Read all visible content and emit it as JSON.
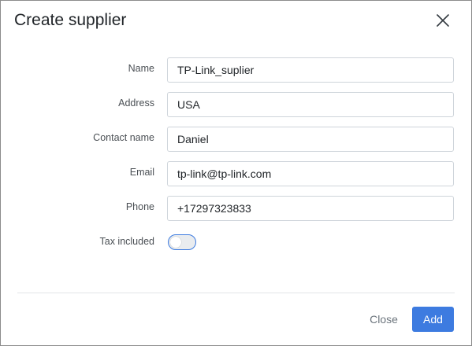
{
  "dialog": {
    "title": "Create supplier",
    "close_icon": "close-icon"
  },
  "form": {
    "fields": [
      {
        "label": "Name",
        "value": "TP-Link_suplier"
      },
      {
        "label": "Address",
        "value": "USA"
      },
      {
        "label": "Contact name",
        "value": "Daniel"
      },
      {
        "label": "Email",
        "value": "tp-link@tp-link.com"
      },
      {
        "label": "Phone",
        "value": "+17297323833"
      }
    ],
    "tax_included": {
      "label": "Tax included",
      "checked": false
    }
  },
  "footer": {
    "close_label": "Close",
    "add_label": "Add"
  },
  "colors": {
    "accent": "#3d7be0",
    "muted_text": "#6c757d",
    "border": "#ced4da"
  }
}
